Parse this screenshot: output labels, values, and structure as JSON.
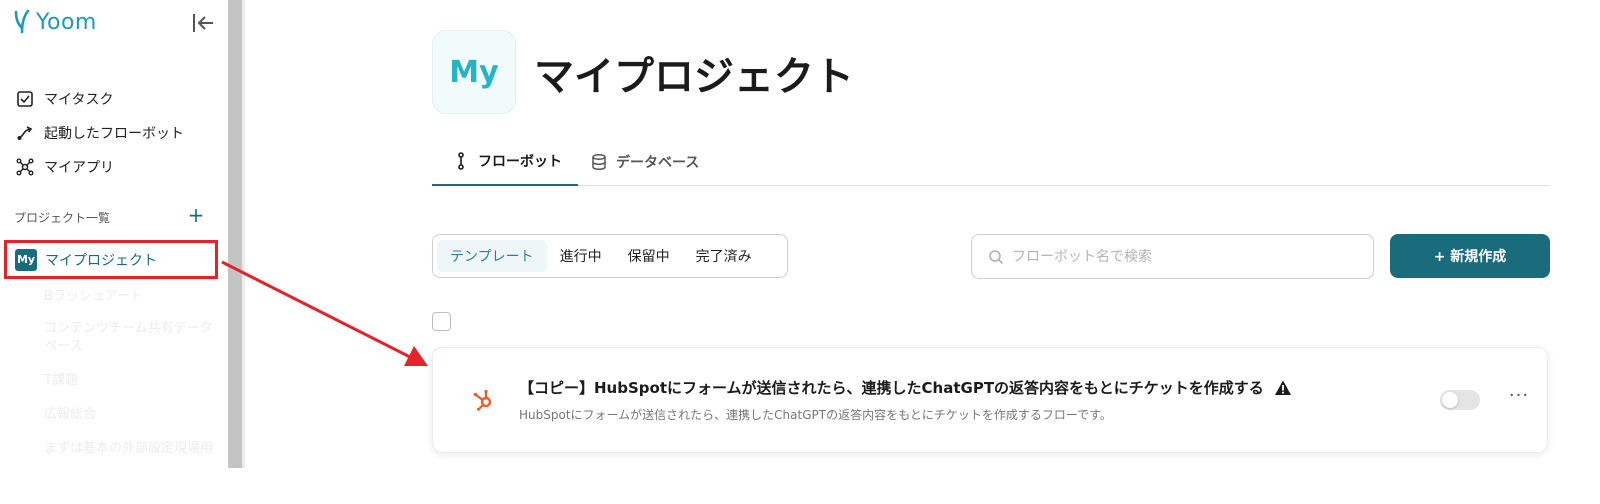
{
  "app": {
    "logo_text": "Yoom"
  },
  "colors": {
    "brand": "#1a6b7c",
    "accent": "#27b3c6",
    "highlight": "#e0242a",
    "hubspot": "#f05a28"
  },
  "sidebar": {
    "nav": [
      {
        "label": "マイタスク",
        "icon": "checkbox-icon"
      },
      {
        "label": "起動したフローボット",
        "icon": "flow-trigger-icon"
      },
      {
        "label": "マイアプリ",
        "icon": "apps-network-icon"
      }
    ],
    "section_title": "プロジェクト一覧",
    "add_label": "+",
    "active_project": {
      "badge": "My",
      "name": "マイプロジェクト"
    },
    "faded_projects": [
      "Bラッシュアート",
      "コンテンツチーム共有データベース",
      "T課題",
      "広報総合",
      "まずは基本の外部設定現場用"
    ]
  },
  "main": {
    "project_badge": "My",
    "title": "マイプロジェクト",
    "tabs": [
      {
        "label": "フローボット",
        "icon": "flowbot-icon",
        "active": true
      },
      {
        "label": "データベース",
        "icon": "database-icon",
        "active": false
      }
    ],
    "filters": [
      {
        "label": "テンプレート",
        "active": true
      },
      {
        "label": "進行中",
        "active": false
      },
      {
        "label": "保留中",
        "active": false
      },
      {
        "label": "完了済み",
        "active": false
      }
    ],
    "search": {
      "placeholder": "フローボット名で検索",
      "value": ""
    },
    "new_button": "+ 新規作成",
    "flows": [
      {
        "title": "【コピー】HubSpotにフォームが送信されたら、連携したChatGPTの返答内容をもとにチケットを作成する",
        "description": "HubSpotにフォームが送信されたら、連携したChatGPTの返答内容をもとにチケットを作成するフローです。",
        "icon": "hubspot-icon",
        "warning": true,
        "enabled": false
      }
    ],
    "more_label": "···"
  }
}
